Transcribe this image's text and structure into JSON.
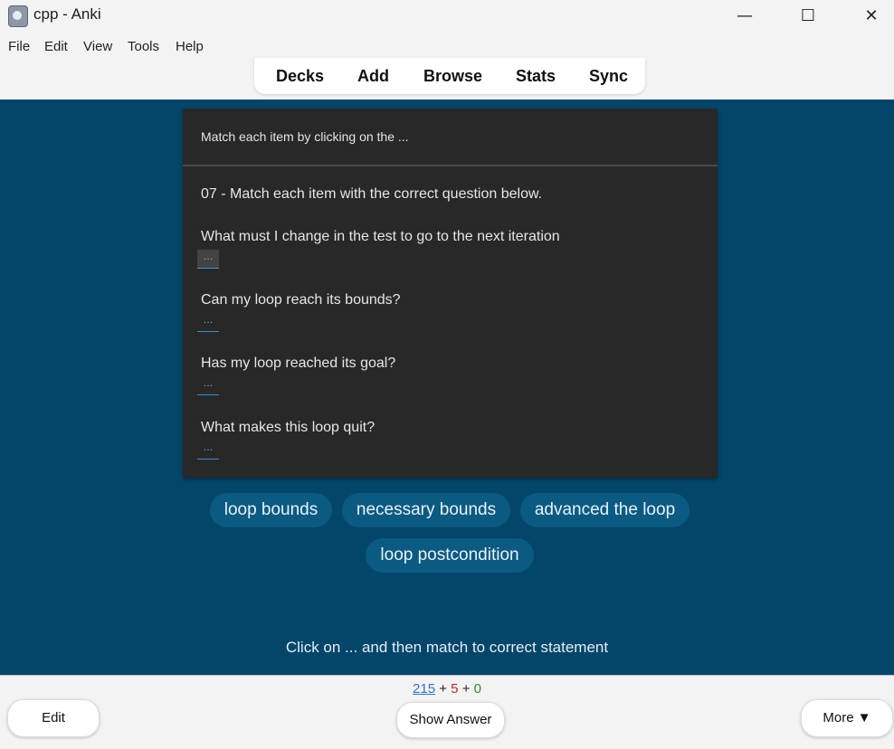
{
  "window": {
    "title": "cpp - Anki",
    "minimize": "—",
    "maximize": "☐",
    "close": "✕"
  },
  "menu": [
    "File",
    "Edit",
    "View",
    "Tools",
    "Help"
  ],
  "toolbar": [
    "Decks",
    "Add",
    "Browse",
    "Stats",
    "Sync"
  ],
  "card": {
    "header": "Match each item by clicking on the ...",
    "intro": "07 - Match each item with the correct question below.",
    "questions": [
      "What must I change in the test to go to the next iteration",
      "Can my loop reach its bounds?",
      "Has my loop reached its goal?",
      "What makes this loop quit?"
    ],
    "slot": "..."
  },
  "choices": [
    "loop bounds",
    "necessary bounds",
    "advanced the loop",
    "loop postcondition"
  ],
  "hint": "Click on ... and then match to correct statement",
  "counts": {
    "new": "215",
    "plus": "+",
    "learn": "5",
    "review": "0"
  },
  "buttons": {
    "edit": "Edit",
    "show_answer": "Show Answer",
    "more": "More ▼"
  }
}
